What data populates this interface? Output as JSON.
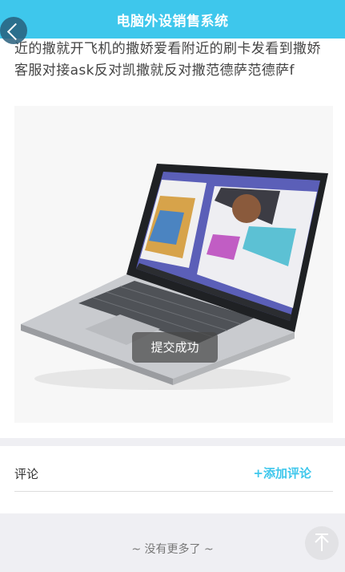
{
  "header": {
    "title": "电脑外设销售系统"
  },
  "article": {
    "text": "近的撒就开飞机的撒娇爱看附近的刷卡发看到撒娇客服对接ask反对凯撒就反对撒范德萨范德萨f"
  },
  "toast": {
    "message": "提交成功"
  },
  "comments": {
    "label": "评论",
    "add_label": "+添加评论"
  },
  "footer": {
    "no_more": "~ 没有更多了 ~"
  },
  "icons": {
    "back": "chevron-left-icon",
    "scroll_top": "arrow-up-icon",
    "product": "laptop-image"
  },
  "colors": {
    "accent": "#3ec7ec",
    "page_background": "#efeff3"
  }
}
